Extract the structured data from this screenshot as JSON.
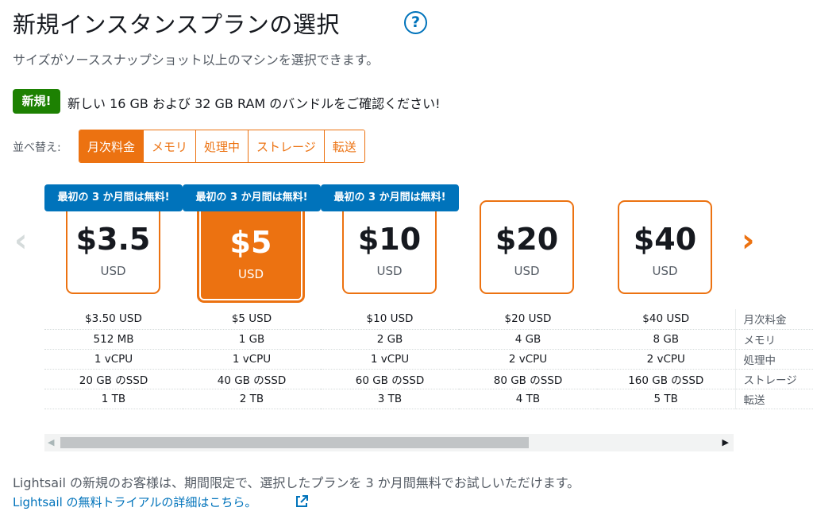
{
  "header": {
    "title": "新規インスタンスプランの選択",
    "help_icon": "?",
    "subtitle": "サイズがソーススナップショット以上のマシンを選択できます。"
  },
  "announcement": {
    "badge": "新規!",
    "text": "新しい 16 GB および 32 GB RAM のバンドルをご確認ください!"
  },
  "sort": {
    "label": "並べ替え:",
    "options": [
      "月次料金",
      "メモリ",
      "処理中",
      "ストレージ",
      "転送"
    ],
    "active": "月次料金"
  },
  "plans": [
    {
      "price": "$3.5",
      "currency": "USD",
      "tag": "最初の 3 か月間は無料!",
      "selected": false
    },
    {
      "price": "$5",
      "currency": "USD",
      "tag": "最初の 3 か月間は無料!",
      "selected": true
    },
    {
      "price": "$10",
      "currency": "USD",
      "tag": "最初の 3 か月間は無料!",
      "selected": false
    },
    {
      "price": "$20",
      "currency": "USD",
      "tag": "",
      "selected": false
    },
    {
      "price": "$40",
      "currency": "USD",
      "tag": "",
      "selected": false
    }
  ],
  "specs": {
    "rows": [
      {
        "label": "月次料金",
        "values": [
          "$3.50 USD",
          "$5 USD",
          "$10 USD",
          "$20 USD",
          "$40 USD"
        ]
      },
      {
        "label": "メモリ",
        "values": [
          "512 MB",
          "1 GB",
          "2 GB",
          "4 GB",
          "8 GB"
        ]
      },
      {
        "label": "処理中",
        "values": [
          "1 vCPU",
          "1 vCPU",
          "1 vCPU",
          "2 vCPU",
          "2 vCPU"
        ]
      },
      {
        "label": "ストレージ",
        "values": [
          "20 GB のSSD",
          "40 GB のSSD",
          "60 GB のSSD",
          "80 GB のSSD",
          "160 GB のSSD"
        ]
      },
      {
        "label": "転送",
        "values": [
          "1 TB",
          "2 TB",
          "3 TB",
          "4 TB",
          "5 TB"
        ]
      }
    ]
  },
  "nav": {
    "prev": "‹",
    "next": "›"
  },
  "scrollbar": {
    "left": "◀",
    "right": "▶"
  },
  "footer": {
    "text": "Lightsail の新規のお客様は、期間限定で、選択したプランを 3 か月間無料でお試しいただけます。",
    "link": "Lightsail の無料トライアルの詳細はこちら。"
  },
  "colors": {
    "accent": "#ec7211",
    "link": "#0073bb",
    "new_badge": "#1d8102"
  }
}
